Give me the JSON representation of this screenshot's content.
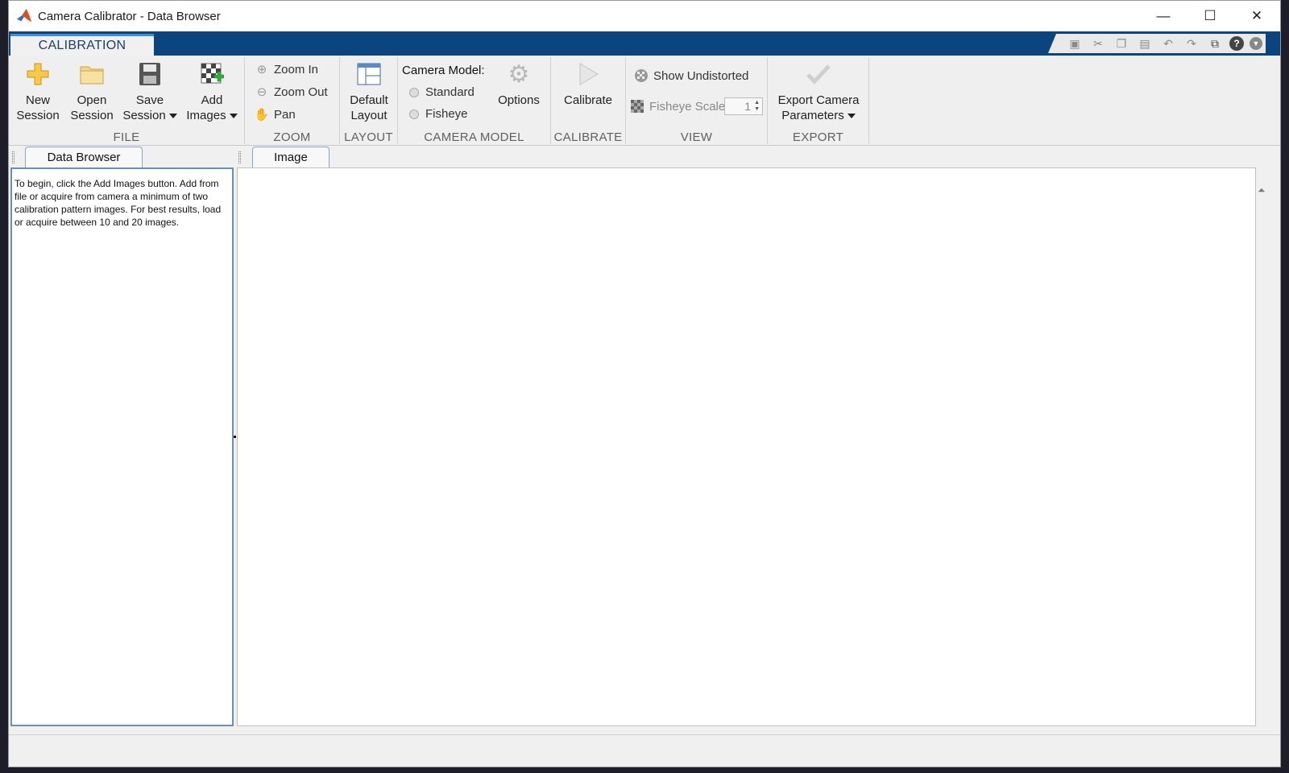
{
  "window": {
    "title": "Camera Calibrator - Data Browser",
    "controls": {
      "minimize": "—",
      "maximize": "☐",
      "close": "✕"
    }
  },
  "toolstrip": {
    "tab_label": "CALIBRATION",
    "quick_access": [
      "save-icon",
      "cut-icon",
      "copy-icon",
      "paste-icon",
      "undo-icon",
      "redo-icon",
      "window-icon",
      "help-icon",
      "menu-icon"
    ]
  },
  "ribbon": {
    "file": {
      "label": "FILE",
      "new_session": [
        "New",
        "Session"
      ],
      "open_session": [
        "Open",
        "Session"
      ],
      "save_session": [
        "Save",
        "Session"
      ],
      "add_images": [
        "Add",
        "Images"
      ]
    },
    "zoom": {
      "label": "ZOOM",
      "zoom_in": "Zoom In",
      "zoom_out": "Zoom Out",
      "pan": "Pan"
    },
    "layout": {
      "label": "LAYOUT",
      "default_layout": [
        "Default",
        "Layout"
      ]
    },
    "camera_model": {
      "label": "CAMERA MODEL",
      "heading": "Camera Model:",
      "standard": "Standard",
      "fisheye": "Fisheye",
      "options": "Options"
    },
    "calibrate": {
      "label": "CALIBRATE",
      "calibrate": "Calibrate"
    },
    "view": {
      "label": "VIEW",
      "show_undistorted": "Show Undistorted",
      "fisheye_scale": "Fisheye Scale",
      "fisheye_scale_value": "1"
    },
    "export": {
      "label": "EXPORT",
      "export_camera": [
        "Export Camera",
        "Parameters"
      ]
    }
  },
  "data_browser": {
    "tab": "Data Browser",
    "message": "To begin, click the Add Images button. Add from file or acquire from camera a minimum of two calibration pattern images. For best results, load or acquire between 10 and 20 images."
  },
  "image_panel": {
    "tab": "Image"
  },
  "colors": {
    "tabstrip": "#0a4580",
    "accent": "#3c8fd8",
    "ribbon_bg": "#efefef"
  }
}
